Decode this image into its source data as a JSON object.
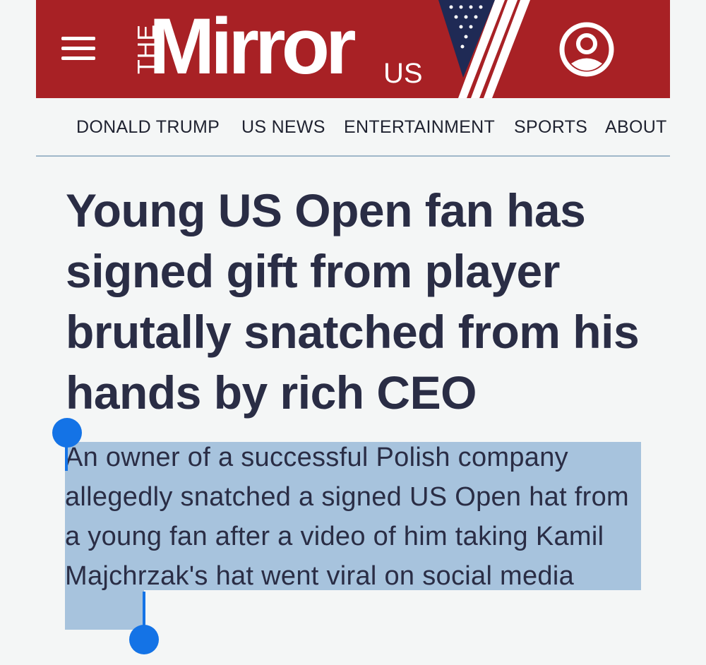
{
  "masthead": {
    "menu_icon": "hamburger-menu-icon",
    "logo_the": "THE",
    "logo_word": "Mirror",
    "logo_region": "US",
    "account_icon": "user-account-icon",
    "brand_color": "#a82125"
  },
  "nav": {
    "items": [
      {
        "label": "DONALD TRUMP"
      },
      {
        "label": "US NEWS"
      },
      {
        "label": "ENTERTAINMENT"
      },
      {
        "label": "SPORTS"
      },
      {
        "label": "ABOUT"
      }
    ]
  },
  "article": {
    "headline": "Young US Open fan has signed gift from player brutally snatched from his hands by rich CEO",
    "standfirst": "An owner of a successful Polish company allegedly snatched a signed US Open hat from a young fan after a video of him taking Kamil Majchrzak's hat went viral on social media"
  },
  "selection": {
    "color": "#a7c3dd",
    "handle_color": "#1473e6",
    "start_handle_icon": "selection-start-handle",
    "end_handle_icon": "selection-end-handle"
  }
}
